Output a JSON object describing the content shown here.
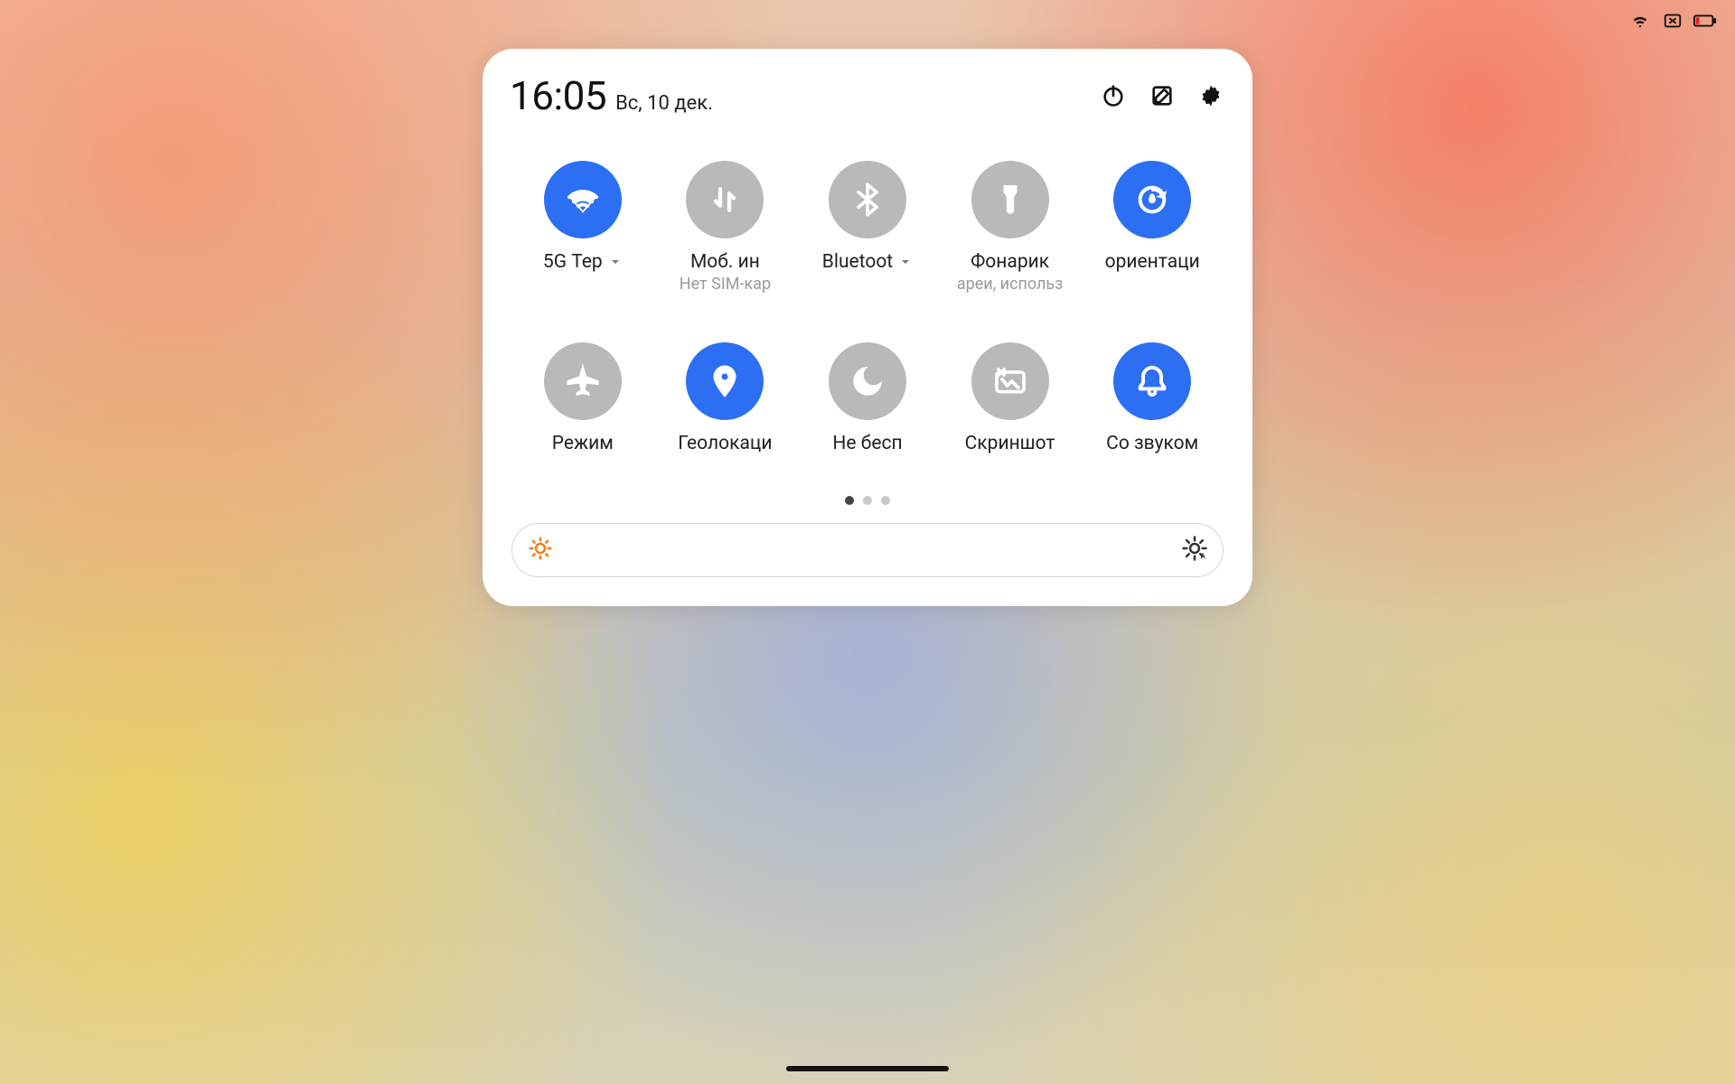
{
  "header": {
    "time": "16:05",
    "date": "Вс, 10 дек."
  },
  "tiles": [
    {
      "id": "wifi",
      "active": true,
      "label": "5G   Тер",
      "sublabel": "",
      "has_caret": true
    },
    {
      "id": "mobiledata",
      "active": false,
      "label": "Моб. ин",
      "sublabel": "Нет SIM-кар",
      "has_caret": false
    },
    {
      "id": "bluetooth",
      "active": false,
      "label": "Bluetoot",
      "sublabel": "",
      "has_caret": true
    },
    {
      "id": "flashlight",
      "active": false,
      "label": "Фонарик",
      "sublabel": "ареи, использ",
      "has_caret": false
    },
    {
      "id": "rotation",
      "active": true,
      "label": "ориентаци",
      "sublabel": "",
      "has_caret": false
    },
    {
      "id": "airplane",
      "active": false,
      "label": "Режим",
      "sublabel": "",
      "has_caret": false
    },
    {
      "id": "location",
      "active": true,
      "label": "Геолокаци",
      "sublabel": "",
      "has_caret": false
    },
    {
      "id": "dnd",
      "active": false,
      "label": "Не бесп",
      "sublabel": "",
      "has_caret": false
    },
    {
      "id": "screenshot",
      "active": false,
      "label": "Скриншот",
      "sublabel": "",
      "has_caret": false
    },
    {
      "id": "sound",
      "active": true,
      "label": "Со звуком",
      "sublabel": "",
      "has_caret": false
    }
  ],
  "pager": {
    "pages": 3,
    "current": 0
  }
}
